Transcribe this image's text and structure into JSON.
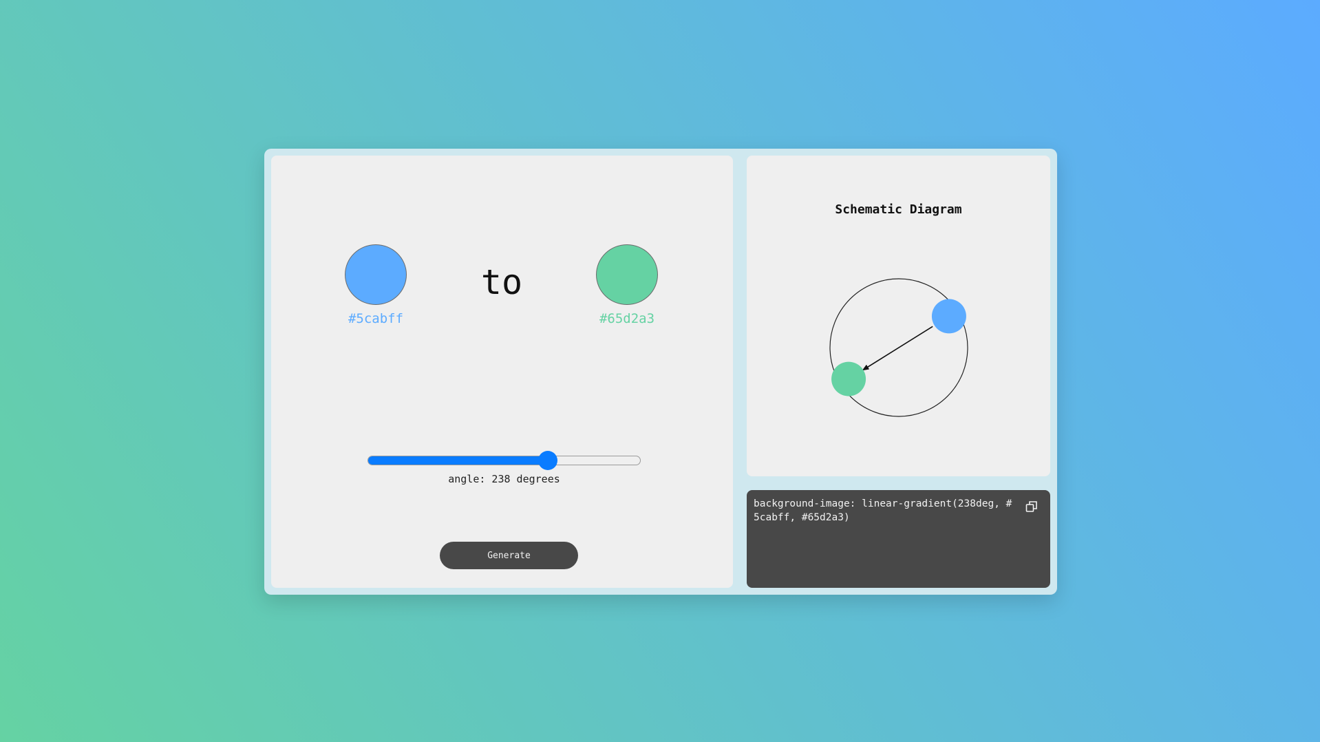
{
  "colors": {
    "from": "#5cabff",
    "to": "#65d2a3",
    "slider_accent": "#0a7cff",
    "button_bg": "#484848",
    "code_bg": "#484848"
  },
  "picker": {
    "from_hex": "#5cabff",
    "connector": "to",
    "to_hex": "#65d2a3"
  },
  "slider": {
    "angle": 238,
    "min": 0,
    "max": 360,
    "label": "angle: 238 degrees"
  },
  "actions": {
    "generate_label": "Generate"
  },
  "diagram": {
    "title": "Schematic Diagram"
  },
  "output": {
    "css_code": "background-image: linear-gradient(238deg, #5cabff, #65d2a3)",
    "copy_icon": "copy-icon"
  }
}
